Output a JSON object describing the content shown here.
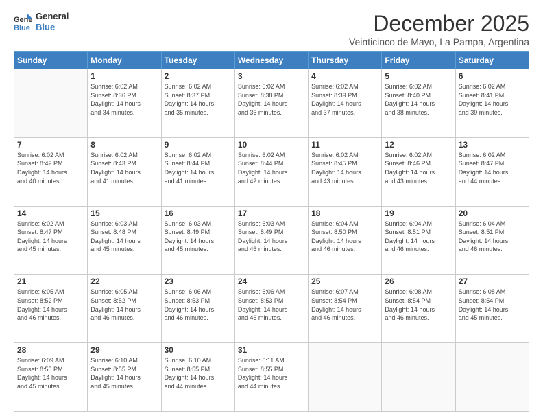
{
  "logo": {
    "line1": "General",
    "line2": "Blue"
  },
  "title": "December 2025",
  "subtitle": "Veinticinco de Mayo, La Pampa, Argentina",
  "weekdays": [
    "Sunday",
    "Monday",
    "Tuesday",
    "Wednesday",
    "Thursday",
    "Friday",
    "Saturday"
  ],
  "weeks": [
    [
      {
        "day": "",
        "info": ""
      },
      {
        "day": "1",
        "info": "Sunrise: 6:02 AM\nSunset: 8:36 PM\nDaylight: 14 hours\nand 34 minutes."
      },
      {
        "day": "2",
        "info": "Sunrise: 6:02 AM\nSunset: 8:37 PM\nDaylight: 14 hours\nand 35 minutes."
      },
      {
        "day": "3",
        "info": "Sunrise: 6:02 AM\nSunset: 8:38 PM\nDaylight: 14 hours\nand 36 minutes."
      },
      {
        "day": "4",
        "info": "Sunrise: 6:02 AM\nSunset: 8:39 PM\nDaylight: 14 hours\nand 37 minutes."
      },
      {
        "day": "5",
        "info": "Sunrise: 6:02 AM\nSunset: 8:40 PM\nDaylight: 14 hours\nand 38 minutes."
      },
      {
        "day": "6",
        "info": "Sunrise: 6:02 AM\nSunset: 8:41 PM\nDaylight: 14 hours\nand 39 minutes."
      }
    ],
    [
      {
        "day": "7",
        "info": "Sunrise: 6:02 AM\nSunset: 8:42 PM\nDaylight: 14 hours\nand 40 minutes."
      },
      {
        "day": "8",
        "info": "Sunrise: 6:02 AM\nSunset: 8:43 PM\nDaylight: 14 hours\nand 41 minutes."
      },
      {
        "day": "9",
        "info": "Sunrise: 6:02 AM\nSunset: 8:44 PM\nDaylight: 14 hours\nand 41 minutes."
      },
      {
        "day": "10",
        "info": "Sunrise: 6:02 AM\nSunset: 8:44 PM\nDaylight: 14 hours\nand 42 minutes."
      },
      {
        "day": "11",
        "info": "Sunrise: 6:02 AM\nSunset: 8:45 PM\nDaylight: 14 hours\nand 43 minutes."
      },
      {
        "day": "12",
        "info": "Sunrise: 6:02 AM\nSunset: 8:46 PM\nDaylight: 14 hours\nand 43 minutes."
      },
      {
        "day": "13",
        "info": "Sunrise: 6:02 AM\nSunset: 8:47 PM\nDaylight: 14 hours\nand 44 minutes."
      }
    ],
    [
      {
        "day": "14",
        "info": "Sunrise: 6:02 AM\nSunset: 8:47 PM\nDaylight: 14 hours\nand 45 minutes."
      },
      {
        "day": "15",
        "info": "Sunrise: 6:03 AM\nSunset: 8:48 PM\nDaylight: 14 hours\nand 45 minutes."
      },
      {
        "day": "16",
        "info": "Sunrise: 6:03 AM\nSunset: 8:49 PM\nDaylight: 14 hours\nand 45 minutes."
      },
      {
        "day": "17",
        "info": "Sunrise: 6:03 AM\nSunset: 8:49 PM\nDaylight: 14 hours\nand 46 minutes."
      },
      {
        "day": "18",
        "info": "Sunrise: 6:04 AM\nSunset: 8:50 PM\nDaylight: 14 hours\nand 46 minutes."
      },
      {
        "day": "19",
        "info": "Sunrise: 6:04 AM\nSunset: 8:51 PM\nDaylight: 14 hours\nand 46 minutes."
      },
      {
        "day": "20",
        "info": "Sunrise: 6:04 AM\nSunset: 8:51 PM\nDaylight: 14 hours\nand 46 minutes."
      }
    ],
    [
      {
        "day": "21",
        "info": "Sunrise: 6:05 AM\nSunset: 8:52 PM\nDaylight: 14 hours\nand 46 minutes."
      },
      {
        "day": "22",
        "info": "Sunrise: 6:05 AM\nSunset: 8:52 PM\nDaylight: 14 hours\nand 46 minutes."
      },
      {
        "day": "23",
        "info": "Sunrise: 6:06 AM\nSunset: 8:53 PM\nDaylight: 14 hours\nand 46 minutes."
      },
      {
        "day": "24",
        "info": "Sunrise: 6:06 AM\nSunset: 8:53 PM\nDaylight: 14 hours\nand 46 minutes."
      },
      {
        "day": "25",
        "info": "Sunrise: 6:07 AM\nSunset: 8:54 PM\nDaylight: 14 hours\nand 46 minutes."
      },
      {
        "day": "26",
        "info": "Sunrise: 6:08 AM\nSunset: 8:54 PM\nDaylight: 14 hours\nand 46 minutes."
      },
      {
        "day": "27",
        "info": "Sunrise: 6:08 AM\nSunset: 8:54 PM\nDaylight: 14 hours\nand 45 minutes."
      }
    ],
    [
      {
        "day": "28",
        "info": "Sunrise: 6:09 AM\nSunset: 8:55 PM\nDaylight: 14 hours\nand 45 minutes."
      },
      {
        "day": "29",
        "info": "Sunrise: 6:10 AM\nSunset: 8:55 PM\nDaylight: 14 hours\nand 45 minutes."
      },
      {
        "day": "30",
        "info": "Sunrise: 6:10 AM\nSunset: 8:55 PM\nDaylight: 14 hours\nand 44 minutes."
      },
      {
        "day": "31",
        "info": "Sunrise: 6:11 AM\nSunset: 8:55 PM\nDaylight: 14 hours\nand 44 minutes."
      },
      {
        "day": "",
        "info": ""
      },
      {
        "day": "",
        "info": ""
      },
      {
        "day": "",
        "info": ""
      }
    ]
  ]
}
